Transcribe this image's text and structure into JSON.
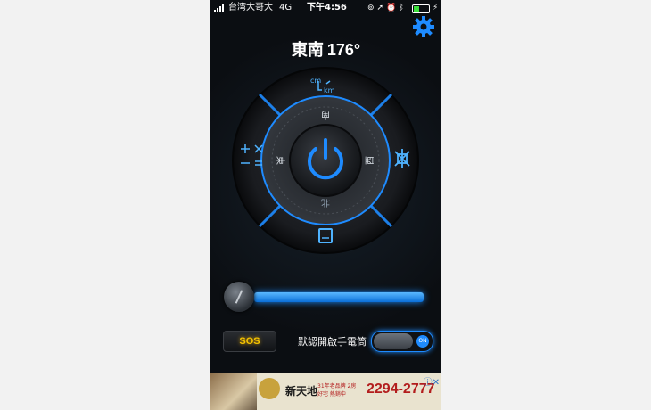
{
  "status_bar": {
    "carrier": "台湾大哥大",
    "network": "4G",
    "time": "下午4:56",
    "icons": [
      "rotation-lock-icon",
      "location-icon",
      "alarm-icon",
      "bluetooth-icon"
    ],
    "battery_level": 0.35,
    "charging": true
  },
  "compass": {
    "direction": "東南",
    "degrees": "176°"
  },
  "dial": {
    "cardinals": {
      "north": "北",
      "south": "南",
      "east": "東",
      "west": "西"
    },
    "top_button": {
      "top_text": "cm",
      "bottom_text": "km"
    },
    "left_button_icon": "calculator-icon",
    "right_button_icon": "flashlight-mode-icon",
    "bottom_button_icon": "screen-light-icon",
    "center_button_icon": "power-icon"
  },
  "brightness_slider": {
    "value": 1.0
  },
  "controls": {
    "sos_label": "SOS",
    "flashlight_default_label": "默認開啟手電筒",
    "toggle_state_label": "ON"
  },
  "ad": {
    "brand": "新天地",
    "promo": "31年老品牌 2房 好宅 熱銷中",
    "phone": "2294-2777"
  },
  "colors": {
    "accent_blue": "#1e8bff",
    "sos_yellow": "#f4c300",
    "background": "#0b0e12"
  }
}
